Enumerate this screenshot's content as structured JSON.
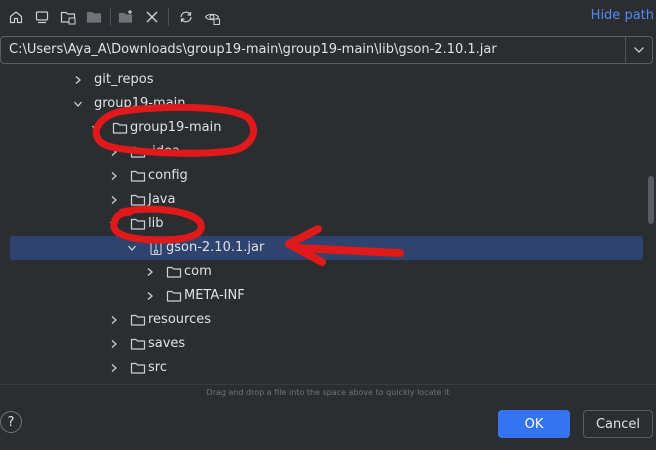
{
  "toolbar": {
    "hide_path_label": "Hide path",
    "buttons": [
      "home-icon",
      "desktop-icon",
      "project-folder-icon",
      "module-folder-icon",
      "new-folder-icon",
      "delete-icon",
      "refresh-icon",
      "show-hidden-icon"
    ]
  },
  "path": {
    "value": "C:\\Users\\Aya_A\\Downloads\\group19-main\\group19-main\\lib\\gson-2.10.1.jar"
  },
  "tree": {
    "rows": [
      {
        "label": "git_repos",
        "expanded": false,
        "icon": "none"
      },
      {
        "label": "group19-main",
        "expanded": true,
        "icon": "none"
      },
      {
        "label": "group19-main",
        "expanded": true,
        "icon": "folder-icon"
      },
      {
        "label": ".idea",
        "expanded": false,
        "icon": "folder-icon"
      },
      {
        "label": "config",
        "expanded": false,
        "icon": "folder-icon"
      },
      {
        "label": "Java",
        "expanded": false,
        "icon": "folder-icon"
      },
      {
        "label": "lib",
        "expanded": true,
        "icon": "folder-icon"
      },
      {
        "label": "gson-2.10.1.jar",
        "expanded": true,
        "icon": "jar-icon",
        "selected": true
      },
      {
        "label": "com",
        "expanded": false,
        "icon": "folder-icon"
      },
      {
        "label": "META-INF",
        "expanded": false,
        "icon": "folder-icon"
      },
      {
        "label": "resources",
        "expanded": false,
        "icon": "folder-icon"
      },
      {
        "label": "saves",
        "expanded": false,
        "icon": "folder-icon"
      },
      {
        "label": "src",
        "expanded": false,
        "icon": "folder-icon"
      }
    ]
  },
  "hint": "Drag and drop a file into the space above to quickly locate it",
  "footer": {
    "help_label": "?",
    "ok_label": "OK",
    "cancel_label": "Cancel"
  },
  "colors": {
    "background": "#2b2d30",
    "selection": "#2e436e",
    "accent": "#3574f0",
    "link": "#548af7",
    "annotation": "#e0191b"
  }
}
